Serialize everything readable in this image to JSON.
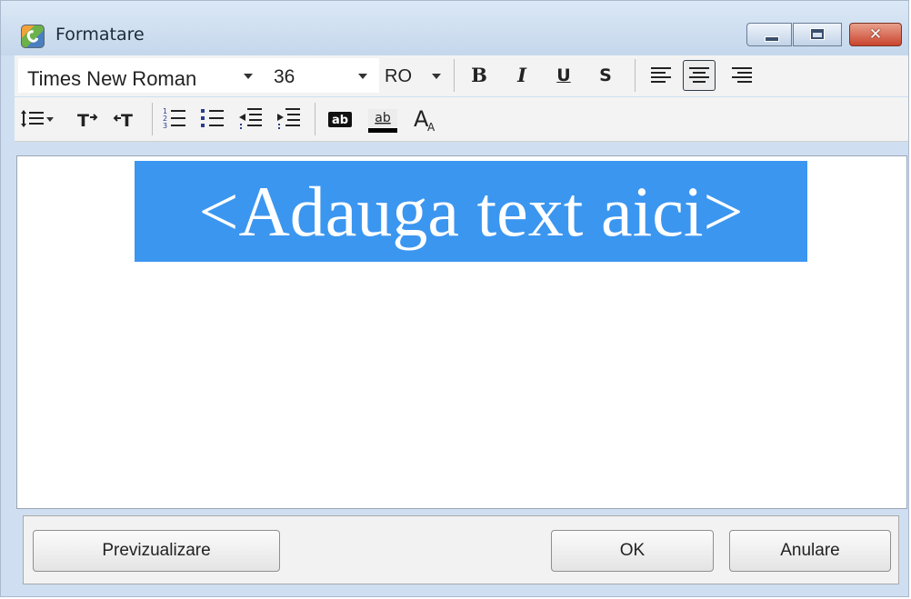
{
  "window": {
    "title": "Formatare",
    "icon": "app-icon",
    "controls": {
      "minimize_icon": "minimize-icon",
      "maximize_icon": "maximize-icon",
      "close_icon": "close-icon",
      "close_glyph": "✕"
    }
  },
  "toolbar1": {
    "font_family": "Times New Roman",
    "font_size": "36",
    "language": "RO",
    "bold_label": "B",
    "italic_label": "I",
    "underline_label": "U",
    "strikethrough_label": "S",
    "align_icons": [
      "align-left-icon",
      "align-center-icon",
      "align-right-icon"
    ],
    "active_alignment": "center"
  },
  "toolbar2": {
    "icons": [
      "line-spacing-icon",
      "superscript-icon",
      "subscript-icon",
      "numbered-list-icon",
      "bulleted-list-icon",
      "decrease-indent-icon",
      "increase-indent-icon",
      "text-background-icon",
      "text-highlight-icon",
      "font-size-icon"
    ],
    "text_background_label": "ab",
    "highlight_label": "ab",
    "font_size_label": "A"
  },
  "editor": {
    "content": "<Adauga text aici>",
    "selection_color": "#3b96f0"
  },
  "buttons": {
    "preview": "Previzualizare",
    "ok": "OK",
    "cancel": "Anulare"
  }
}
